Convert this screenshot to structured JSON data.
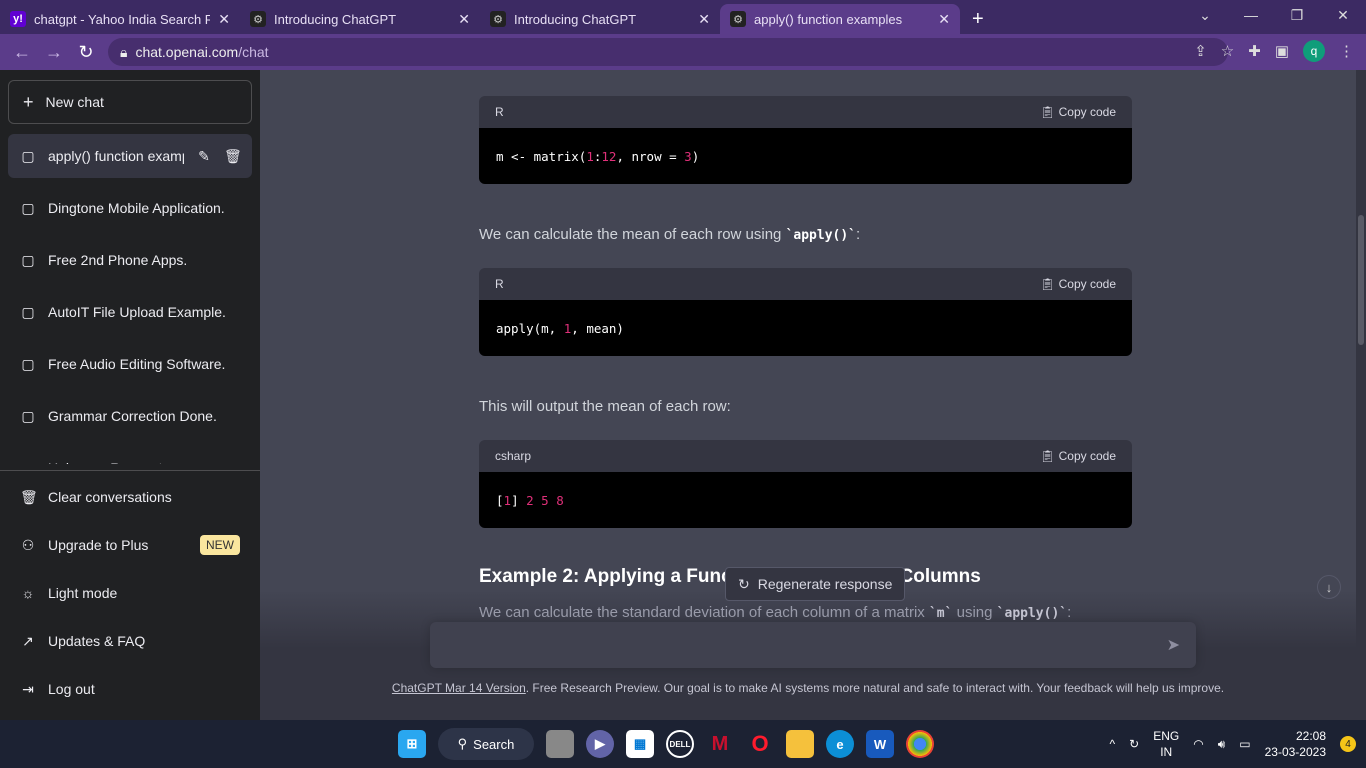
{
  "browser": {
    "tabs": [
      {
        "title": "chatgpt - Yahoo India Search Res",
        "icon": "yahoo-icon",
        "fav": "y!"
      },
      {
        "title": "Introducing ChatGPT",
        "icon": "openai-icon",
        "fav": "⚙"
      },
      {
        "title": "Introducing ChatGPT",
        "icon": "openai-icon",
        "fav": "⚙"
      },
      {
        "title": "apply() function examples",
        "icon": "openai-icon",
        "fav": "⚙"
      }
    ],
    "url_host": "chat.openai.com",
    "url_path": "/chat",
    "profile": "q"
  },
  "sidebar": {
    "new_chat": "New chat",
    "conversations": [
      "apply() function exampl",
      "Dingtone Mobile Application.",
      "Free 2nd Phone Apps.",
      "AutoIT File Upload Example.",
      "Free Audio Editing Software.",
      "Grammar Correction Done.",
      "Unknown Request"
    ],
    "bottom": [
      {
        "label": "Clear conversations",
        "icon": "trash-icon"
      },
      {
        "label": "Upgrade to Plus",
        "icon": "user-icon",
        "badge": "NEW"
      },
      {
        "label": "Light mode",
        "icon": "sun-icon"
      },
      {
        "label": "Updates & FAQ",
        "icon": "external-link-icon"
      },
      {
        "label": "Log out",
        "icon": "logout-icon"
      }
    ]
  },
  "main": {
    "copy_label": "Copy code",
    "blocks": [
      {
        "lang": "R",
        "code": [
          [
            "m <- matrix(",
            ""
          ],
          [
            "1",
            "n"
          ],
          [
            ":",
            ""
          ],
          [
            "12",
            "n"
          ],
          [
            ", nrow = ",
            ""
          ],
          [
            "3",
            "n"
          ],
          [
            ")",
            ""
          ]
        ]
      },
      {
        "lang": "R",
        "code": [
          [
            "apply(m, ",
            ""
          ],
          [
            "1",
            "n"
          ],
          [
            ", mean)",
            ""
          ]
        ]
      },
      {
        "lang": "csharp",
        "code": [
          [
            "[",
            ""
          ],
          [
            "1",
            "n"
          ],
          [
            "] ",
            ""
          ],
          [
            "2 5 8",
            "n"
          ]
        ]
      }
    ],
    "para1_pre": "We can calculate the mean of each row using ",
    "para1_code": "`apply()`",
    "para1_post": ":",
    "para2": "This will output the mean of each row:",
    "heading": "Example 2: Applying a Function to a Matrix by Columns",
    "para3_pre": "We can calculate the standard deviation of each column of a matrix ",
    "para3_code1": "`m`",
    "para3_mid": " using ",
    "para3_code2": "`apply()`",
    "para3_post": ":",
    "regenerate": "Regenerate response",
    "footer_link": "ChatGPT Mar 14 Version",
    "footer_text": ". Free Research Preview. Our goal is to make AI systems more natural and safe to interact with. Your feedback will help us improve."
  },
  "taskbar": {
    "search": "Search",
    "lang1": "ENG",
    "lang2": "IN",
    "time": "22:08",
    "date": "23-03-2023",
    "notifications": "4"
  },
  "colors": {
    "sidebar": "#202123",
    "main": "#444654",
    "accent_num": "#df3079",
    "browser": "#5b3c8a"
  }
}
